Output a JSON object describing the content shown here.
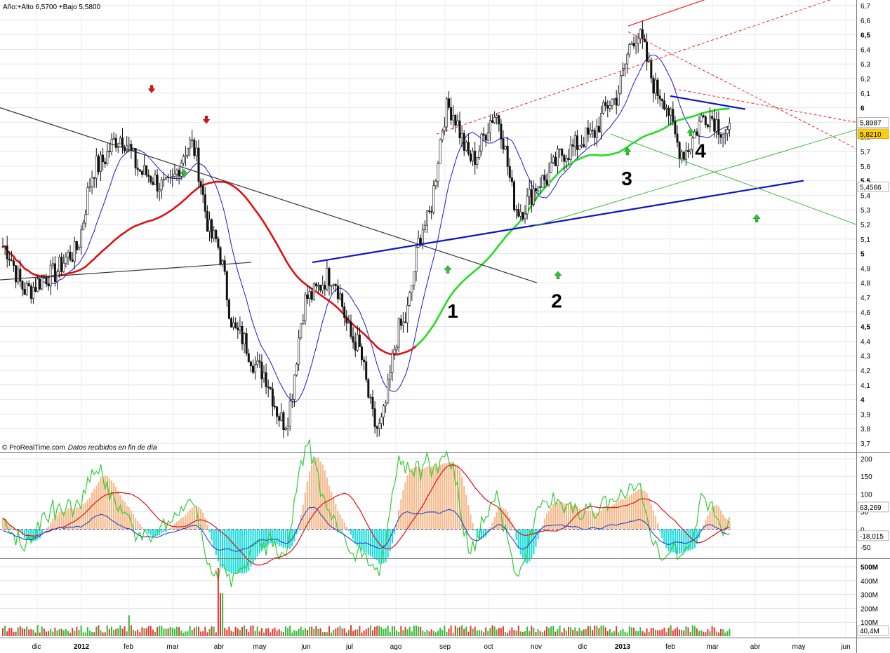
{
  "header": {
    "range_text": "Año:+Alto 6,5700 +Bajo 5,5800"
  },
  "credit": {
    "source": "© ProRealTime.com",
    "note": "Datos recibidos en fin de día"
  },
  "colors": {
    "sma_red": "#e01010",
    "sma_green": "#22dd22",
    "sma_blue": "#1a1acc",
    "trend_blue": "#1010cc",
    "trend_black": "#333333",
    "channel_red": "#ee2222",
    "fan_green": "#44bb44",
    "up_arrow": "#22cc22",
    "down_arrow": "#dd1111",
    "osc_green": "#33cc33",
    "osc_orange": "#f5b98a",
    "osc_cyan": "#22dddd",
    "osc_blue": "#2244cc",
    "volume_red": "#ee3333",
    "volume_green": "#33bb33"
  },
  "chart_data": [
    {
      "type": "candlestick",
      "title": "",
      "y_ticks": [
        "6,7",
        "6,6",
        "6,5",
        "6,4",
        "6,3",
        "6,2",
        "6,1",
        "6",
        "5,9",
        "5,8",
        "5,7",
        "5,6",
        "5,5",
        "5,4",
        "5,3",
        "5,2",
        "5,1",
        "5",
        "4,9",
        "4,8",
        "4,7",
        "4,6",
        "4,5",
        "4,4",
        "4,3",
        "4,2",
        "4,1",
        "4",
        "3,9",
        "3,8",
        "3,7"
      ],
      "bold_ticks": [
        "6,5",
        "6",
        "5,5",
        "5",
        "4,5",
        "4"
      ],
      "ylim": [
        3.7,
        6.75
      ],
      "x_ticks": [
        "dic",
        "2012",
        "feb",
        "mar",
        "abr",
        "may",
        "jun",
        "jul",
        "ago",
        "sep",
        "oct",
        "nov",
        "dic",
        "2013",
        "feb",
        "mar",
        "abr",
        "may",
        "jun"
      ],
      "bold_x_ticks": [
        "2012",
        "2013"
      ],
      "price_points": [
        [
          "dic",
          5.05
        ],
        [
          "dic",
          4.75
        ],
        [
          "2012",
          4.85
        ],
        [
          "2012",
          5.0
        ],
        [
          "feb",
          5.6
        ],
        [
          "feb",
          5.8
        ],
        [
          "mar",
          5.55
        ],
        [
          "mar",
          5.45
        ],
        [
          "abr",
          5.75
        ],
        [
          "abr",
          5.1
        ],
        [
          "may",
          4.45
        ],
        [
          "may",
          4.2
        ],
        [
          "jun",
          3.85
        ],
        [
          "jun",
          4.7
        ],
        [
          "jul",
          4.85
        ],
        [
          "jul",
          4.4
        ],
        [
          "ago",
          3.8
        ],
        [
          "ago",
          4.5
        ],
        [
          "sep",
          5.2
        ],
        [
          "sep",
          6.0
        ],
        [
          "oct",
          5.65
        ],
        [
          "oct",
          5.95
        ],
        [
          "nov",
          5.3
        ],
        [
          "nov",
          5.5
        ],
        [
          "dic",
          5.7
        ],
        [
          "dic",
          5.8
        ],
        [
          "2013",
          6.05
        ],
        [
          "2013",
          6.5
        ],
        [
          "feb",
          6.1
        ],
        [
          "feb",
          5.7
        ],
        [
          "mar",
          5.95
        ],
        [
          "mar",
          5.82
        ]
      ],
      "last_values": [
        "5,8987",
        "5,8210",
        "5,4566"
      ],
      "wave_labels": [
        "1",
        "2",
        "3",
        "4"
      ]
    },
    {
      "type": "area",
      "y_ticks": [
        "200",
        "150",
        "100",
        "50",
        "0",
        "-50"
      ],
      "ylim": [
        -80,
        210
      ],
      "last_values": [
        "63,269",
        "-18,015"
      ]
    },
    {
      "type": "bar",
      "y_ticks": [
        "500M",
        "400M",
        "300M",
        "200M",
        "100M"
      ],
      "ylim": [
        0,
        520
      ],
      "last_values": [
        "40,4M"
      ],
      "spikes": [
        [
          "abr",
          490
        ],
        [
          "abr",
          310
        ],
        [
          "feb",
          150
        ]
      ]
    }
  ]
}
